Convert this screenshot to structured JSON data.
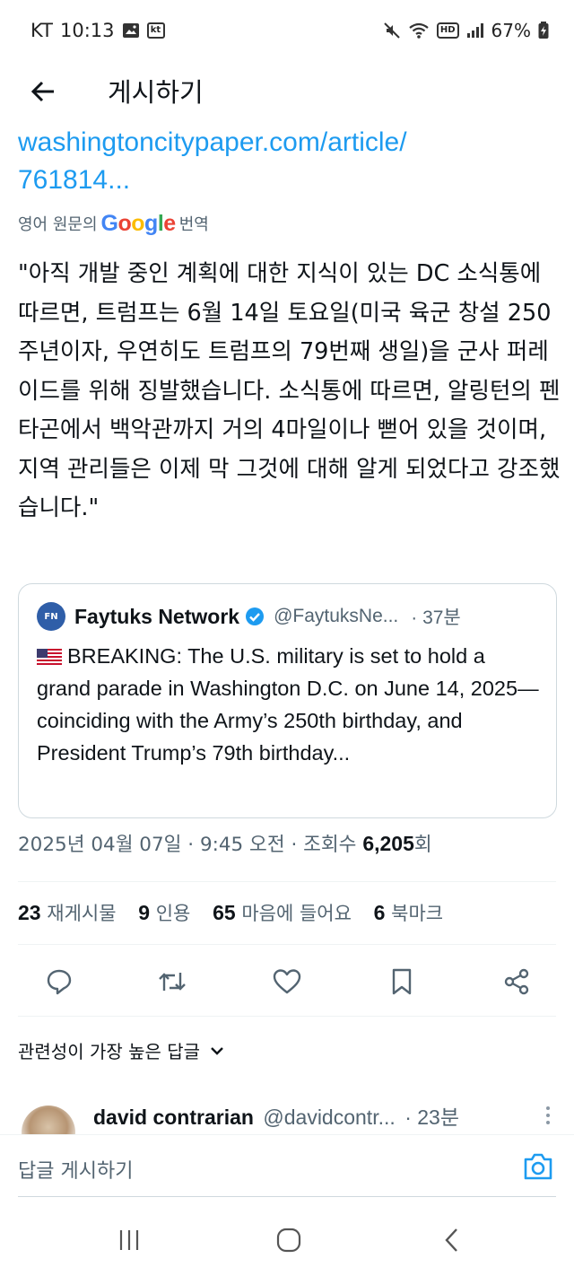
{
  "status_bar": {
    "carrier": "KT",
    "time": "10:13",
    "kt_badge": "kt",
    "hd_badge": "HD",
    "battery": "67%"
  },
  "header": {
    "title": "게시하기"
  },
  "tweet": {
    "link_line1": "washingtoncitypaper.com/article/",
    "link_line2": "761814...",
    "translate_prefix": "영어 원문의",
    "translate_brand": "Google",
    "translate_suffix": "번역",
    "body": "\"아직 개발 중인 계획에 대한 지식이 있는 DC 소식통에 따르면, 트럼프는 6월 14일 토요일(미국 육군 창설 250주년이자, 우연히도 트럼프의 79번째 생일)을 군사 퍼레이드를 위해 징발했습니다. 소식통에 따르면, 알링턴의 펜타곤에서 백악관까지 거의 4마일이나 뻗어 있을 것이며, 지역 관리들은 이제 막 그것에 대해 알게 되었다고 강조했습니다.\"",
    "quote": {
      "avatar_text": "FN",
      "name": "Faytuks Network",
      "handle": "@FaytuksNe...",
      "time": "· 37분",
      "text": "BREAKING: The U.S. military is set to hold a grand parade in Washington D.C. on June 14, 2025—coinciding with the Army’s 250th birthday, and President Trump’s 79th birthday..."
    },
    "meta": {
      "datetime": "2025년 04월 07일 · 9:45 오전 · 조회수",
      "views": "6,205",
      "views_suffix": "회"
    },
    "stats": [
      {
        "num": "23",
        "label": "재게시물"
      },
      {
        "num": "9",
        "label": "인용"
      },
      {
        "num": "65",
        "label": "마음에 들어요"
      },
      {
        "num": "6",
        "label": "북마크"
      }
    ]
  },
  "actions": {
    "icons": [
      "reply-icon",
      "retweet-icon",
      "like-icon",
      "bookmark-icon",
      "share-icon"
    ]
  },
  "replies": {
    "filter_label": "관련성이 가장 높은 답글",
    "first_reply": {
      "name": "david contrarian",
      "handle": "@davidcontr...",
      "time": "· 23분"
    }
  },
  "composer": {
    "placeholder": "답글 게시하기"
  },
  "colors": {
    "accent": "#1d9bf0",
    "text_primary": "#0f1419",
    "text_secondary": "#536471",
    "border": "#cfd9de"
  }
}
